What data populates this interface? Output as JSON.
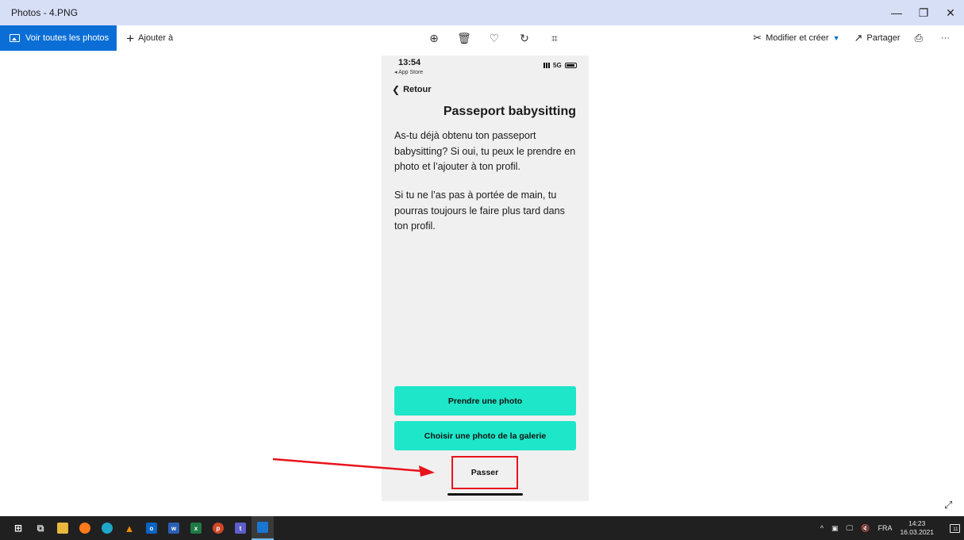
{
  "window": {
    "title": "Photos - 4.PNG",
    "minimize_glyph": "—",
    "restore_glyph": "❐",
    "close_glyph": "✕"
  },
  "toolbar": {
    "view_all_label": "Voir toutes les photos",
    "add_to_label": "Ajouter à",
    "edit_create_label": "Modifier et créer",
    "share_label": "Partager",
    "zoom_glyph": "⊕",
    "delete_glyph": "🗑",
    "favorite_glyph": "♡",
    "rotate_glyph": "↻",
    "crop_glyph": "⌗",
    "print_glyph": "⎙",
    "more_glyph": "···"
  },
  "phone": {
    "status_time": "13:54",
    "status_back_app": "◂ App Store",
    "status_network": "5G",
    "back_label": "Retour",
    "page_title": "Passeport babysitting",
    "paragraph_1": "As-tu déjà obtenu ton passeport babysitting? Si oui, tu peux le prendre en photo et l’ajouter à ton profil.",
    "paragraph_2": "Si tu ne l’as pas à portée de main, tu pourras toujours le faire plus tard dans ton profil.",
    "take_photo_label": "Prendre une photo",
    "choose_gallery_label": "Choisir une photo de la galerie",
    "skip_label": "Passer"
  },
  "annotation": {
    "arrow_color": "#e8131c",
    "box_color": "#e8131c"
  },
  "taskbar": {
    "language": "FRA",
    "time": "14:23",
    "date": "16.03.2021",
    "notification_count": "11"
  },
  "colors": {
    "accent": "#0b6ed6",
    "button_teal": "#1ee6c8",
    "titlebar": "#d7dff7",
    "taskbar": "#202020"
  }
}
